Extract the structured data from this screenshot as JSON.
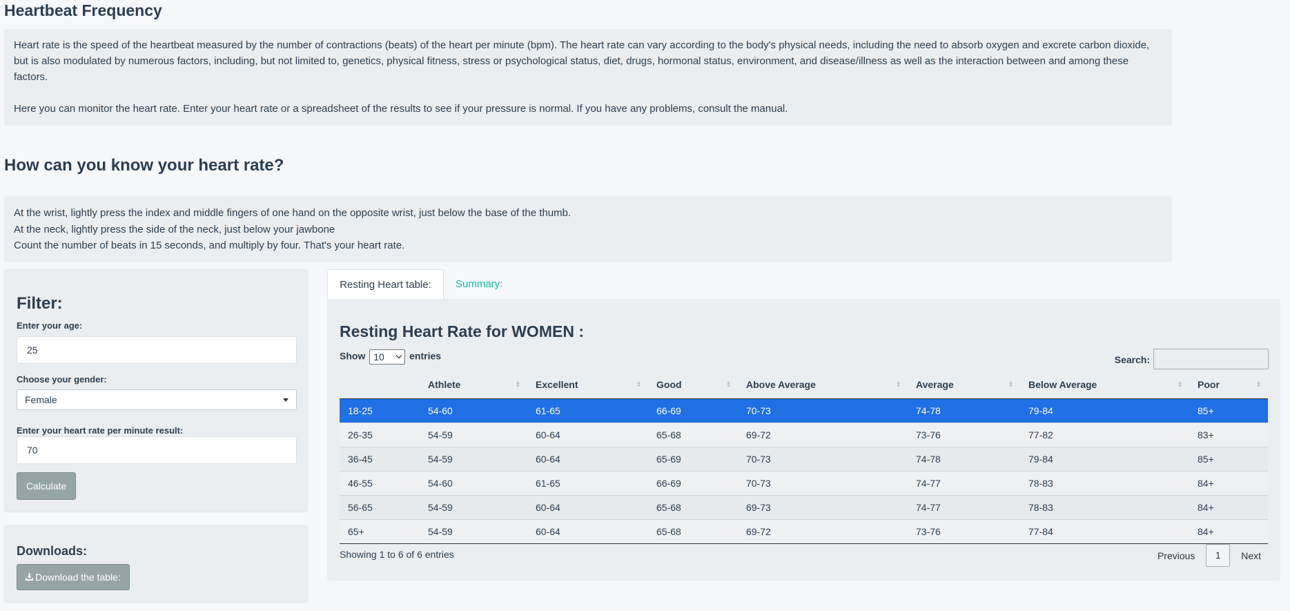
{
  "header": {
    "title": "Heartbeat Frequency"
  },
  "intro": {
    "paragraph1": "Heart rate is the speed of the heartbeat measured by the number of contractions (beats) of the heart per minute (bpm). The heart rate can vary according to the body's physical needs, including the need to absorb oxygen and excrete carbon dioxide, but is also modulated by numerous factors, including, but not limited to, genetics, physical fitness, stress or psychological status, diet, drugs, hormonal status, environment, and disease/illness as well as the interaction between and among these factors.",
    "paragraph2": "Here you can monitor the heart rate. Enter your heart rate or a spreadsheet of the results to see if your pressure is normal. If you have any problems, consult the manual."
  },
  "howto": {
    "title": "How can you know your heart rate?",
    "lines": [
      "At the wrist, lightly press the index and middle fingers of one hand on the opposite wrist, just below the base of the thumb.",
      "At the neck, lightly press the side of the neck, just below your jawbone",
      "Count the number of beats in 15 seconds, and multiply by four. That's your heart rate."
    ]
  },
  "filter": {
    "title": "Filter:",
    "age_label": "Enter your age:",
    "age_value": "25",
    "gender_label": "Choose your gender:",
    "gender_value": "Female",
    "rate_label": "Enter your heart rate per minute result:",
    "rate_value": "70",
    "calculate_label": "Calculate"
  },
  "downloads": {
    "title": "Downloads:",
    "button_label": "Download the table:",
    "button_icon": "download-icon"
  },
  "tabs": [
    {
      "label": "Resting Heart table:",
      "active": true
    },
    {
      "label": "Summary:",
      "active": false
    }
  ],
  "table": {
    "title": "Resting Heart Rate for WOMEN :",
    "show_label": "Show",
    "page_length": "10",
    "entries_label": "entries",
    "search_label": "Search:",
    "search_value": "",
    "columns": [
      "",
      "Athlete",
      "Excellent",
      "Good",
      "Above Average",
      "Average",
      "Below Average",
      "Poor"
    ],
    "rows": [
      [
        "18-25",
        "54-60",
        "61-65",
        "66-69",
        "70-73",
        "74-78",
        "79-84",
        "85+"
      ],
      [
        "26-35",
        "54-59",
        "60-64",
        "65-68",
        "69-72",
        "73-76",
        "77-82",
        "83+"
      ],
      [
        "36-45",
        "54-59",
        "60-64",
        "65-69",
        "70-73",
        "74-78",
        "79-84",
        "85+"
      ],
      [
        "46-55",
        "54-60",
        "61-65",
        "66-69",
        "70-73",
        "74-77",
        "78-83",
        "84+"
      ],
      [
        "56-65",
        "54-59",
        "60-64",
        "65-68",
        "69-73",
        "74-77",
        "78-83",
        "84+"
      ],
      [
        "65+",
        "54-59",
        "60-64",
        "65-68",
        "69-72",
        "73-76",
        "77-84",
        "84+"
      ]
    ],
    "selected_row": 0,
    "info": "Showing 1 to 6 of 6 entries",
    "pagination": {
      "previous": "Previous",
      "current": "1",
      "next": "Next"
    },
    "highlight_color": "#1f6fe5"
  }
}
